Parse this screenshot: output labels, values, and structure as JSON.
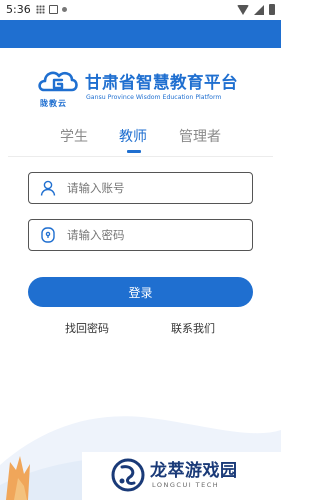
{
  "status_bar": {
    "time": "5:36",
    "icons": [
      "grid-icon",
      "a-icon",
      "dot-icon",
      "wifi-icon",
      "signal-icon",
      "battery-icon"
    ]
  },
  "header": {
    "accent_color": "#1f6fd0"
  },
  "logo": {
    "icon": "cloud-g-logo-icon",
    "badge_text": "陇教云",
    "title": "甘肃省智慧教育平台",
    "subtitle": "Gansu Province Wisdom Education Platform"
  },
  "tabs": [
    {
      "label": "学生",
      "active": false
    },
    {
      "label": "教师",
      "active": true
    },
    {
      "label": "管理者",
      "active": false
    }
  ],
  "form": {
    "account_placeholder": "请输入账号",
    "password_placeholder": "请输入密码",
    "login_label": "登录"
  },
  "links": {
    "forgot": "找回密码",
    "contact": "联系我们"
  },
  "watermark": {
    "title": "龙萃游戏园",
    "subtitle": "LONGCUI TECH"
  }
}
